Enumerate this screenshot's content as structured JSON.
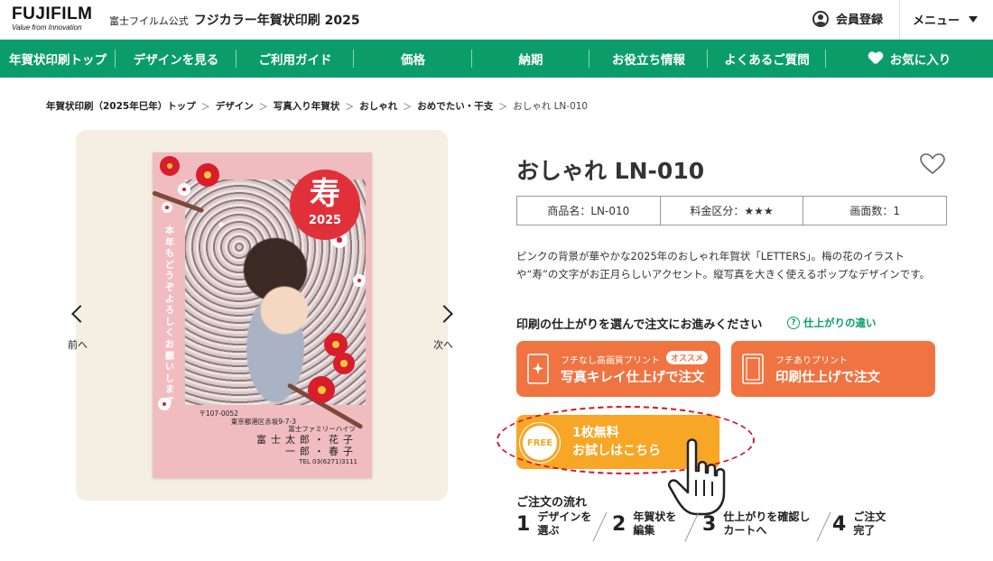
{
  "header": {
    "logo_main": "FUJIFILM",
    "logo_sub": "Value from Innovation",
    "site_prefix": "富士フイルム公式",
    "site_title": "フジカラー年賀状印刷 2025",
    "member_label": "会員登録",
    "menu_label": "メニュー"
  },
  "nav": {
    "items": [
      "年賀状印刷トップ",
      "デザインを見る",
      "ご利用ガイド",
      "価格",
      "納期",
      "お役立ち情報",
      "よくあるご質問"
    ],
    "favorite_label": "お気に入り"
  },
  "breadcrumb": [
    "年賀状印刷（2025年巳年）トップ",
    "デザイン",
    "写真入り年賀状",
    "おしゃれ",
    "おめでたい・干支",
    "おしゃれ LN-010"
  ],
  "preview": {
    "kotobuki": "寿",
    "year": "2025",
    "greeting": "本年もどうぞよろしくお願いします",
    "postal": "〒107-0052",
    "address1": "東京都港区赤坂9-7-3",
    "address2": "富士ファミリーハイツ",
    "name1": "富士太郎・花子",
    "name2": "一郎・春子",
    "tel": "TEL 03(6271)3111",
    "prev_label": "前へ",
    "next_label": "次へ"
  },
  "product": {
    "title": "おしゃれ LN-010",
    "specs": [
      "商品名：LN-010",
      "料金区分：★★★",
      "画面数：1"
    ],
    "description": "ピンクの背景が華やかな2025年のおしゃれ年賀状「LETTERS」。梅の花のイラストや“寿”の文字がお正月らしいアクセント。縦写真を大きく使えるポップなデザインです。",
    "choose_label": "印刷の仕上がりを選んで注文にお進みください",
    "help_label": "仕上がりの違い"
  },
  "buttons": {
    "photo_sub": "フチなし高画質プリント",
    "photo_badge": "オススメ",
    "photo_main": "写真キレイ仕上げで注文",
    "print_sub": "フチありプリント",
    "print_main": "印刷仕上げで注文",
    "trial_badge": "FREE",
    "trial_line1": "1枚無料",
    "trial_line2": "お試しはこちら"
  },
  "flow": {
    "title": "ご注文の流れ",
    "steps": [
      {
        "num": "1",
        "text": "デザインを\n選ぶ"
      },
      {
        "num": "2",
        "text": "年賀状を\n編集"
      },
      {
        "num": "3",
        "text": "仕上がりを確認し\nカートへ"
      },
      {
        "num": "4",
        "text": "ご注文\n完了"
      }
    ]
  },
  "colors": {
    "brand_green": "#0a9d6a",
    "order_orange": "#f07342",
    "trial_yellow": "#f8a626",
    "card_pink": "#f1bcc0",
    "highlight_red": "#d9142a"
  },
  "icons": [
    "user-icon",
    "caret-down-icon",
    "heart-icon",
    "chevron-left-icon",
    "chevron-right-icon",
    "question-icon",
    "sparkle-icon",
    "frame-icon",
    "free-badge-icon",
    "hand-pointer-icon"
  ]
}
